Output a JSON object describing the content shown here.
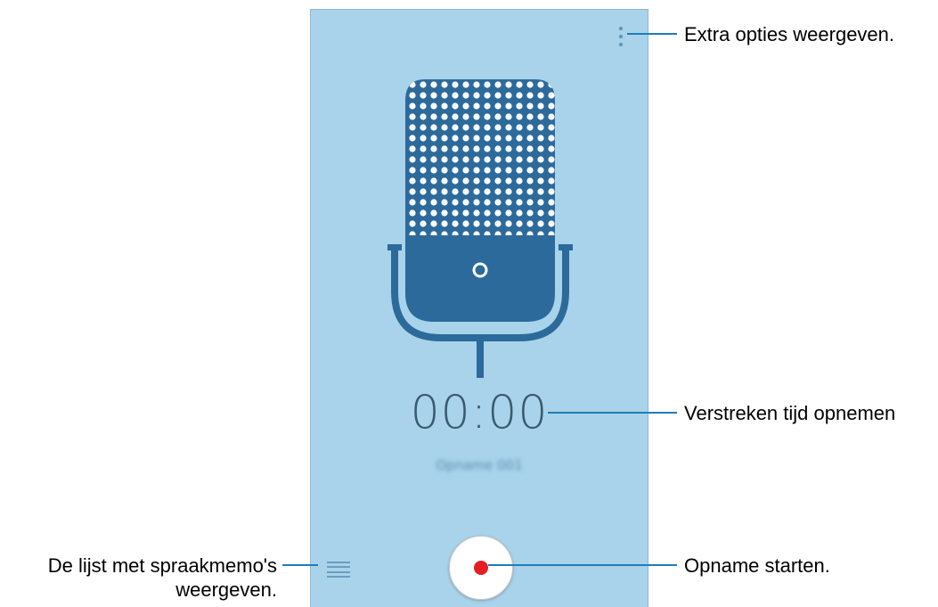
{
  "screen": {
    "timer": "00:00",
    "recording_name": "Opname 001"
  },
  "icons": {
    "more_options": "more-vertical-icon",
    "recordings_list": "list-icon",
    "record": "record-icon",
    "microphone": "microphone-illustration"
  },
  "callouts": {
    "more_options": "Extra opties weergeven.",
    "elapsed_time": "Verstreken tijd opnemen",
    "start_recording": "Opname starten.",
    "list_line1": "De lijst met spraakmemo's",
    "list_line2": "weergeven."
  },
  "colors": {
    "screen_background": "#a8d3ea",
    "microphone": "#2c6a9b",
    "record_dot": "#e31e24",
    "callout_line": "#1f7db8"
  }
}
